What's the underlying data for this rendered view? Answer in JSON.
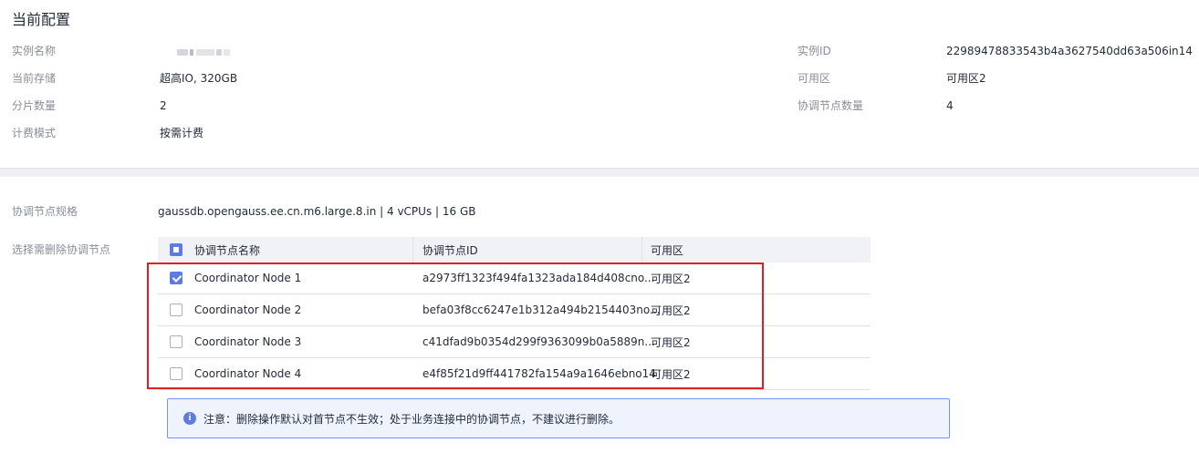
{
  "section": {
    "title": "当前配置"
  },
  "config": {
    "left": [
      {
        "label": "实例名称",
        "value": ""
      },
      {
        "label": "当前存储",
        "value": "超高IO, 320GB"
      },
      {
        "label": "分片数量",
        "value": "2"
      },
      {
        "label": "计费模式",
        "value": "按需计费"
      }
    ],
    "right": [
      {
        "label": "实例ID",
        "value": "22989478833543b4a3627540dd63a506in14"
      },
      {
        "label": "可用区",
        "value": "可用区2"
      },
      {
        "label": "协调节点数量",
        "value": "4"
      }
    ]
  },
  "spec": {
    "label": "协调节点规格",
    "value": "gaussdb.opengauss.ee.cn.m6.large.8.in | 4 vCPUs | 16 GB"
  },
  "select_label": "选择需删除协调节点",
  "table": {
    "header_checkbox_state": "indeterminate",
    "columns": [
      "协调节点名称",
      "协调节点ID",
      "可用区"
    ],
    "rows": [
      {
        "checked": true,
        "name": "Coordinator Node 1",
        "id": "a2973ff1323f494fa1323ada184d408cno...",
        "az": "可用区2"
      },
      {
        "checked": false,
        "name": "Coordinator Node 2",
        "id": "befa03f8cc6247e1b312a494b2154403no...",
        "az": "可用区2"
      },
      {
        "checked": false,
        "name": "Coordinator Node 3",
        "id": "c41dfad9b0354d299f9363099b0a5889n...",
        "az": "可用区2"
      },
      {
        "checked": false,
        "name": "Coordinator Node 4",
        "id": "e4f85f21d9ff441782fa154a9a1646ebno14",
        "az": "可用区2"
      }
    ]
  },
  "notice": {
    "icon": "info-icon",
    "text": "注意：删除操作默认对首节点不生效；处于业务连接中的协调节点，不建议进行删除。"
  },
  "colors": {
    "accent": "#5e7ce0",
    "highlight_border": "#e02020",
    "notice_bg": "#eef3fe",
    "notice_border": "#7693f5"
  }
}
